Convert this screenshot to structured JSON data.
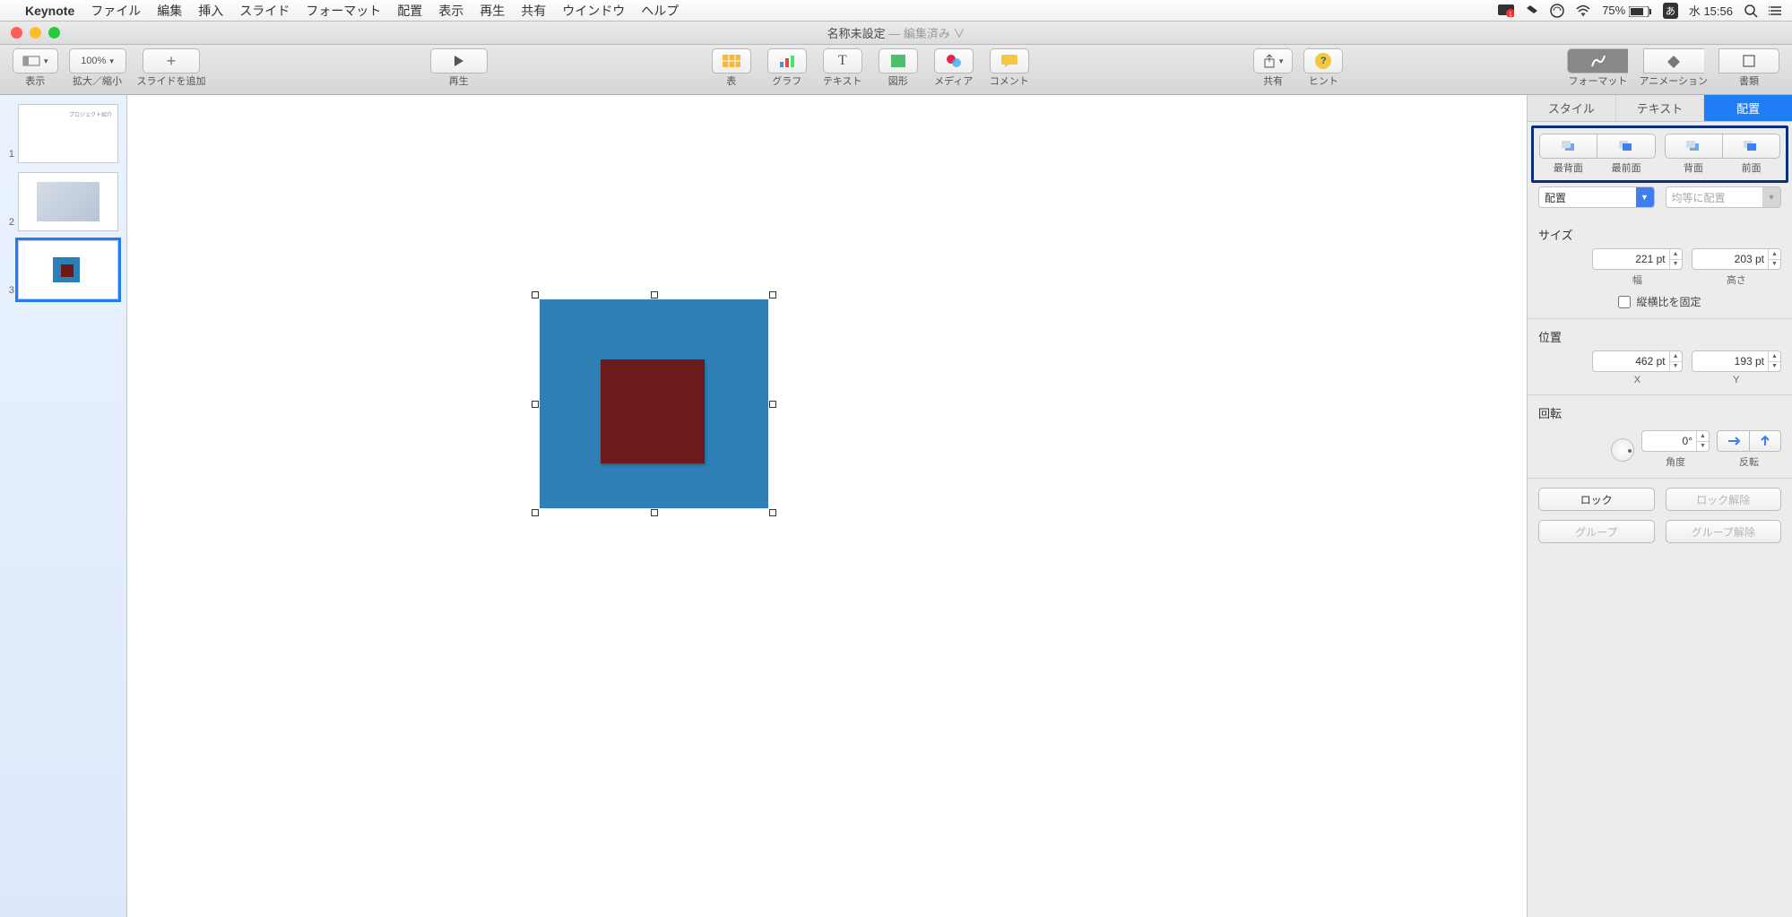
{
  "menubar": {
    "apple": "",
    "app": "Keynote",
    "items": [
      "ファイル",
      "編集",
      "挿入",
      "スライド",
      "フォーマット",
      "配置",
      "表示",
      "再生",
      "共有",
      "ウインドウ",
      "ヘルプ"
    ],
    "battery": "75%",
    "ime": "あ",
    "clock": "水 15:56"
  },
  "window": {
    "title": "名称未設定",
    "edited": "— 編集済み ∨"
  },
  "toolbar": {
    "view": "表示",
    "zoom": "拡大／縮小",
    "zoom_value": "100%",
    "addslide": "スライドを追加",
    "play": "再生",
    "table": "表",
    "chart": "グラフ",
    "text": "テキスト",
    "shape": "図形",
    "media": "メディア",
    "comment": "コメント",
    "share": "共有",
    "hint": "ヒント",
    "format": "フォーマット",
    "animation": "アニメーション",
    "document": "書類"
  },
  "nav": {
    "n1": "1",
    "n2": "2",
    "n3": "3",
    "txt1": "プロジェクト紹介"
  },
  "inspector": {
    "tabs": {
      "style": "スタイル",
      "text": "テキスト",
      "arrange": "配置"
    },
    "arrange": {
      "back": "最背面",
      "front": "最前面",
      "backward": "背面",
      "forward": "前面"
    },
    "align_dd": "配置",
    "dist_dd": "均等に配置",
    "size_lbl": "サイズ",
    "w_val": "221 pt",
    "h_val": "203 pt",
    "w_lbl": "幅",
    "h_lbl": "高さ",
    "lock_ratio": "縦横比を固定",
    "pos_lbl": "位置",
    "x_val": "462 pt",
    "y_val": "193 pt",
    "x_lbl": "X",
    "y_lbl": "Y",
    "rot_lbl": "回転",
    "angle_val": "0°",
    "angle_lbl": "角度",
    "flip_lbl": "反転",
    "lock": "ロック",
    "unlock": "ロック解除",
    "group": "グループ",
    "ungroup": "グループ解除"
  }
}
